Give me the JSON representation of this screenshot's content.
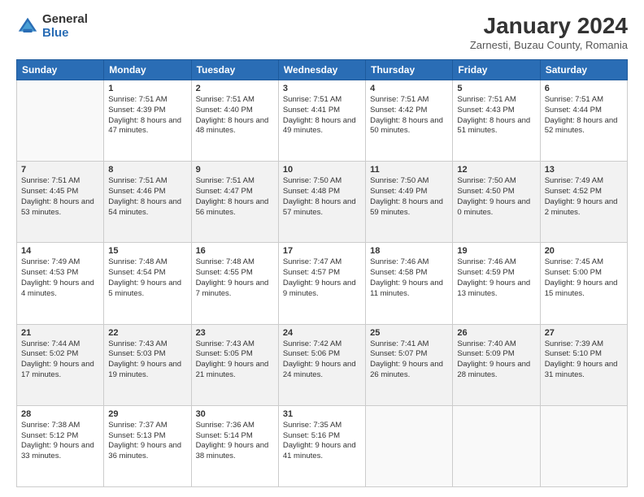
{
  "logo": {
    "general": "General",
    "blue": "Blue"
  },
  "header": {
    "month": "January 2024",
    "location": "Zarnesti, Buzau County, Romania"
  },
  "weekdays": [
    "Sunday",
    "Monday",
    "Tuesday",
    "Wednesday",
    "Thursday",
    "Friday",
    "Saturday"
  ],
  "weeks": [
    [
      {
        "day": "",
        "empty": true
      },
      {
        "day": "1",
        "sunrise": "7:51 AM",
        "sunset": "4:39 PM",
        "daylight": "8 hours and 47 minutes."
      },
      {
        "day": "2",
        "sunrise": "7:51 AM",
        "sunset": "4:40 PM",
        "daylight": "8 hours and 48 minutes."
      },
      {
        "day": "3",
        "sunrise": "7:51 AM",
        "sunset": "4:41 PM",
        "daylight": "8 hours and 49 minutes."
      },
      {
        "day": "4",
        "sunrise": "7:51 AM",
        "sunset": "4:42 PM",
        "daylight": "8 hours and 50 minutes."
      },
      {
        "day": "5",
        "sunrise": "7:51 AM",
        "sunset": "4:43 PM",
        "daylight": "8 hours and 51 minutes."
      },
      {
        "day": "6",
        "sunrise": "7:51 AM",
        "sunset": "4:44 PM",
        "daylight": "8 hours and 52 minutes."
      }
    ],
    [
      {
        "day": "7",
        "sunrise": "7:51 AM",
        "sunset": "4:45 PM",
        "daylight": "8 hours and 53 minutes."
      },
      {
        "day": "8",
        "sunrise": "7:51 AM",
        "sunset": "4:46 PM",
        "daylight": "8 hours and 54 minutes."
      },
      {
        "day": "9",
        "sunrise": "7:51 AM",
        "sunset": "4:47 PM",
        "daylight": "8 hours and 56 minutes."
      },
      {
        "day": "10",
        "sunrise": "7:50 AM",
        "sunset": "4:48 PM",
        "daylight": "8 hours and 57 minutes."
      },
      {
        "day": "11",
        "sunrise": "7:50 AM",
        "sunset": "4:49 PM",
        "daylight": "8 hours and 59 minutes."
      },
      {
        "day": "12",
        "sunrise": "7:50 AM",
        "sunset": "4:50 PM",
        "daylight": "9 hours and 0 minutes."
      },
      {
        "day": "13",
        "sunrise": "7:49 AM",
        "sunset": "4:52 PM",
        "daylight": "9 hours and 2 minutes."
      }
    ],
    [
      {
        "day": "14",
        "sunrise": "7:49 AM",
        "sunset": "4:53 PM",
        "daylight": "9 hours and 4 minutes."
      },
      {
        "day": "15",
        "sunrise": "7:48 AM",
        "sunset": "4:54 PM",
        "daylight": "9 hours and 5 minutes."
      },
      {
        "day": "16",
        "sunrise": "7:48 AM",
        "sunset": "4:55 PM",
        "daylight": "9 hours and 7 minutes."
      },
      {
        "day": "17",
        "sunrise": "7:47 AM",
        "sunset": "4:57 PM",
        "daylight": "9 hours and 9 minutes."
      },
      {
        "day": "18",
        "sunrise": "7:46 AM",
        "sunset": "4:58 PM",
        "daylight": "9 hours and 11 minutes."
      },
      {
        "day": "19",
        "sunrise": "7:46 AM",
        "sunset": "4:59 PM",
        "daylight": "9 hours and 13 minutes."
      },
      {
        "day": "20",
        "sunrise": "7:45 AM",
        "sunset": "5:00 PM",
        "daylight": "9 hours and 15 minutes."
      }
    ],
    [
      {
        "day": "21",
        "sunrise": "7:44 AM",
        "sunset": "5:02 PM",
        "daylight": "9 hours and 17 minutes."
      },
      {
        "day": "22",
        "sunrise": "7:43 AM",
        "sunset": "5:03 PM",
        "daylight": "9 hours and 19 minutes."
      },
      {
        "day": "23",
        "sunrise": "7:43 AM",
        "sunset": "5:05 PM",
        "daylight": "9 hours and 21 minutes."
      },
      {
        "day": "24",
        "sunrise": "7:42 AM",
        "sunset": "5:06 PM",
        "daylight": "9 hours and 24 minutes."
      },
      {
        "day": "25",
        "sunrise": "7:41 AM",
        "sunset": "5:07 PM",
        "daylight": "9 hours and 26 minutes."
      },
      {
        "day": "26",
        "sunrise": "7:40 AM",
        "sunset": "5:09 PM",
        "daylight": "9 hours and 28 minutes."
      },
      {
        "day": "27",
        "sunrise": "7:39 AM",
        "sunset": "5:10 PM",
        "daylight": "9 hours and 31 minutes."
      }
    ],
    [
      {
        "day": "28",
        "sunrise": "7:38 AM",
        "sunset": "5:12 PM",
        "daylight": "9 hours and 33 minutes."
      },
      {
        "day": "29",
        "sunrise": "7:37 AM",
        "sunset": "5:13 PM",
        "daylight": "9 hours and 36 minutes."
      },
      {
        "day": "30",
        "sunrise": "7:36 AM",
        "sunset": "5:14 PM",
        "daylight": "9 hours and 38 minutes."
      },
      {
        "day": "31",
        "sunrise": "7:35 AM",
        "sunset": "5:16 PM",
        "daylight": "9 hours and 41 minutes."
      },
      {
        "day": "",
        "empty": true
      },
      {
        "day": "",
        "empty": true
      },
      {
        "day": "",
        "empty": true
      }
    ]
  ],
  "labels": {
    "sunrise": "Sunrise:",
    "sunset": "Sunset:",
    "daylight": "Daylight:"
  }
}
